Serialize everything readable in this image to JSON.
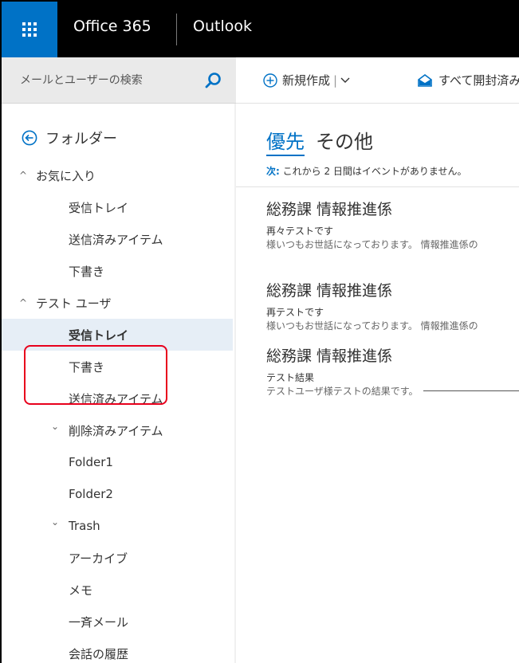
{
  "topbar": {
    "brand": "Office 365",
    "app": "Outlook"
  },
  "search": {
    "placeholder": "メールとユーザーの検索"
  },
  "commands": {
    "new_label": "新規作成",
    "mark_all_read": "すべて開封済み"
  },
  "folders": {
    "header": "フォルダー",
    "items": [
      {
        "label": "お気に入り",
        "chevron": "^",
        "level": 0
      },
      {
        "label": "受信トレイ",
        "level": 1
      },
      {
        "label": "送信済みアイテム",
        "level": 1
      },
      {
        "label": "下書き",
        "level": 1
      },
      {
        "label": "テスト ユーザ",
        "chevron": "^",
        "level": 0
      },
      {
        "label": "受信トレイ",
        "level": 1,
        "selected": true
      },
      {
        "label": "下書き",
        "level": 1
      },
      {
        "label": "送信済みアイテム",
        "level": 1
      },
      {
        "label": "削除済みアイテム",
        "chevron": "v",
        "level": 1
      },
      {
        "label": "Folder1",
        "level": 2
      },
      {
        "label": "Folder2",
        "level": 2
      },
      {
        "label": "Trash",
        "chevron": "v",
        "level": 1
      },
      {
        "label": "アーカイブ",
        "level": 1
      },
      {
        "label": "メモ",
        "level": 1
      },
      {
        "label": "一斉メール",
        "level": 1
      },
      {
        "label": "会話の履歴",
        "level": 1
      }
    ]
  },
  "messages": {
    "tab_focused": "優先",
    "tab_other": "その他",
    "next_label": "次:",
    "next_text": "これから 2 日間はイベントがありません。",
    "items": [
      {
        "sender": "総務課 情報推進係",
        "subject": "再々テストです",
        "preview": "様いつもお世話になっております。 情報推進係の"
      },
      {
        "sender": "総務課 情報推進係",
        "subject": "再テストです",
        "preview": "様いつもお世話になっております。 情報推進係の"
      },
      {
        "sender": "総務課 情報推進係",
        "subject": "テスト結果",
        "preview": "テストユーザ様テストの結果です。"
      }
    ]
  },
  "colors": {
    "accent": "#0072c6",
    "topbar": "#000000",
    "highlight": "#e8001c",
    "selected_bg": "#e6eef6"
  }
}
